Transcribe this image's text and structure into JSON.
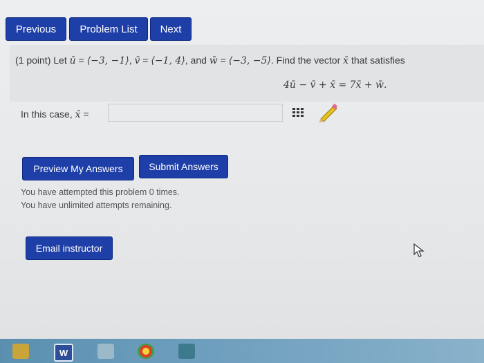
{
  "nav": {
    "previous_label": "Previous",
    "problem_list_label": "Problem List",
    "next_label": "Next"
  },
  "problem": {
    "points": "(1 point)",
    "let": "Let",
    "u_vec": "ū",
    "u_val": "⟨−3, −1⟩",
    "v_vec": "v̄",
    "v_val": "⟨−1, 4⟩",
    "and": "and",
    "w_vec": "w̄",
    "w_val": "⟨−3, −5⟩",
    "find_prefix": "Find the vector",
    "x_vec": "x̄",
    "find_suffix": "that satisfies",
    "equation": "4ū − v̄ + x̄ = 7x̄ + w̄."
  },
  "answer": {
    "label": "In this case,",
    "x_vec": "x̄",
    "equals": "=",
    "value": ""
  },
  "actions": {
    "preview_label": "Preview My Answers",
    "submit_label": "Submit Answers",
    "email_label": "Email instructor"
  },
  "attempts": {
    "line1": "You have attempted this problem 0 times.",
    "line2": "You have unlimited attempts remaining."
  },
  "taskbar": {
    "word_label": "W"
  },
  "colors": {
    "button_blue": "#1f3fa8",
    "panel_gray": "#e1e3e5"
  }
}
